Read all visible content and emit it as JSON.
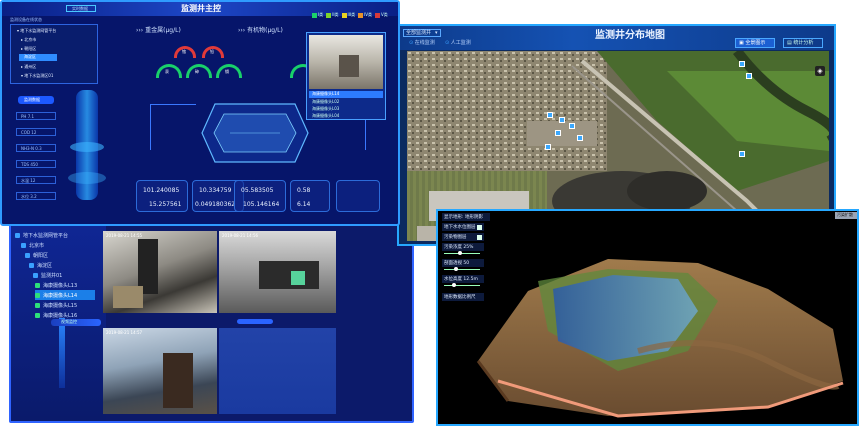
{
  "main": {
    "title": "监测井主控",
    "top_tab": "实时数据",
    "top_left_label": "监测设备在线状态",
    "section_heavy_metal": "重金属(μg/L)",
    "section_organic": "有机物(μg/L)",
    "legend_levels": [
      "I类",
      "II类",
      "III类",
      "IV类",
      "V类"
    ],
    "legend_colors": [
      "#1bd16a",
      "#7fd42a",
      "#e8d21f",
      "#e8922a",
      "#d63a3a"
    ],
    "gauge_labels_red": [
      "铬",
      "铅"
    ],
    "gauge_labels_green": [
      "汞",
      "砷",
      "镉"
    ],
    "tree": [
      "地下水监测网管平台",
      "北京市",
      "朝阳区",
      "海淀区",
      "通州区",
      "地下水监测区01"
    ],
    "sidebar_buttons": [
      "监测数据",
      "PH 7.1",
      "COD 12",
      "NH3-N 0.3",
      "TDS 450",
      "水温 12",
      "水位 3.2"
    ],
    "camera_list": [
      "海康摄像头L14",
      "海康摄像头L02",
      "海康摄像头L03",
      "海康摄像头L04"
    ],
    "values": [
      {
        "top": "101.240085",
        "bottom": "15.257561"
      },
      {
        "top": "10.334759",
        "bottom": "0.049180362"
      },
      {
        "top": "05.583505",
        "bottom": "105.146164"
      },
      {
        "top": "0.58",
        "bottom": "6.14"
      }
    ]
  },
  "map": {
    "title": "监测井分布地图",
    "dropdown": "全部监测井",
    "tab1": "在线监测",
    "tab2": "人工监测",
    "btn_full": "全景图示",
    "btn_stat": "统计分析"
  },
  "video": {
    "tree": [
      "地下水监测网管平台",
      "北京市",
      "朝阳区",
      "海淀区",
      "监测井01",
      "海康摄像头L13",
      "海康摄像头L14",
      "海康摄像头L15",
      "海康摄像头L16"
    ],
    "cam_labels": [
      "2019-08-21 14:55",
      "2019-08-21 14:56",
      "2019-08-21 14:57",
      ""
    ],
    "bottom_tab": "视频监控"
  },
  "terrain": {
    "top_right": "污染扩散",
    "controls": [
      "显示地形: 地形阴影",
      "地下水水位图层",
      "污染物图层",
      "污染浓度 25%",
      "剖面透视 50",
      "水位高度 12.5m",
      "地形数据比例尺"
    ]
  }
}
